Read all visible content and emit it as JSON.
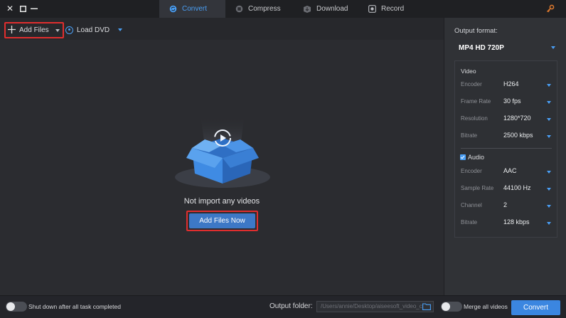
{
  "window": {
    "close_glyph": "✕",
    "maximize_glyph": "☐",
    "minimize_glyph": "—"
  },
  "tabs": [
    {
      "label": "Convert",
      "icon": "convert-icon",
      "active": true
    },
    {
      "label": "Compress",
      "icon": "compress-icon",
      "active": false
    },
    {
      "label": "Download",
      "icon": "download-icon",
      "active": false
    },
    {
      "label": "Record",
      "icon": "record-icon",
      "active": false
    }
  ],
  "toolbar": {
    "add_files_label": "Add Files",
    "load_dvd_label": "Load DVD"
  },
  "main": {
    "empty_text": "Not import any videos",
    "add_now_label": "Add Files Now"
  },
  "panel": {
    "output_format_label": "Output format:",
    "output_format_value": "MP4 HD 720P",
    "video": {
      "title": "Video",
      "rows": [
        {
          "key": "Encoder",
          "value": "H264"
        },
        {
          "key": "Frame Rate",
          "value": "30 fps"
        },
        {
          "key": "Resolution",
          "value": "1280*720"
        },
        {
          "key": "Bitrate",
          "value": "2500 kbps"
        }
      ]
    },
    "audio": {
      "title": "Audio",
      "checked": true,
      "rows": [
        {
          "key": "Encoder",
          "value": "AAC"
        },
        {
          "key": "Sample Rate",
          "value": "44100 Hz"
        },
        {
          "key": "Channel",
          "value": "2"
        },
        {
          "key": "Bitrate",
          "value": "128 kbps"
        }
      ]
    }
  },
  "bottom": {
    "shutdown_label": "Shut down after all task completed",
    "output_folder_label": "Output folder:",
    "output_folder_value": "/Users/annie/Desktop/aiseesoft_video_c",
    "merge_label": "Merge all videos",
    "convert_label": "Convert"
  },
  "colors": {
    "accent": "#4a9ff5",
    "highlight": "#e02e2e",
    "primary_button": "#3b86e0"
  }
}
